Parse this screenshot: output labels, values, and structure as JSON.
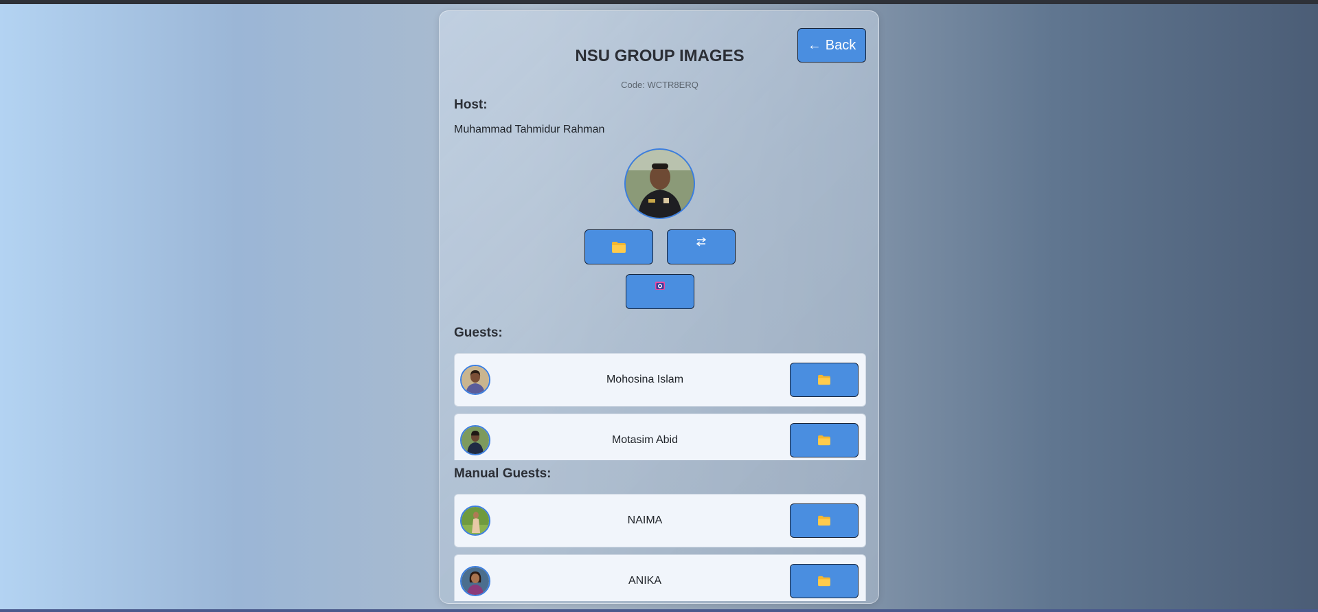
{
  "header": {
    "title": "NSU GROUP IMAGES",
    "code_text": "Code: WCTR8ERQ",
    "back_label": "Back",
    "back_arrow": "←"
  },
  "host": {
    "section_label": "Host:",
    "name": "Muhammad Tahmidur Rahman",
    "actions": [
      {
        "name": "folder-button",
        "icon": "folder-icon"
      },
      {
        "name": "swap-button",
        "icon": "swap-arrows-icon"
      },
      {
        "name": "camera-button",
        "icon": "camera-icon"
      }
    ]
  },
  "guests": {
    "section_label": "Guests:",
    "items": [
      {
        "name": "Mohosina Islam",
        "action_icon": "folder-icon"
      },
      {
        "name": "Motasim Abid",
        "action_icon": "folder-icon"
      }
    ]
  },
  "manual_guests": {
    "section_label": "Manual Guests:",
    "items": [
      {
        "name": "NAIMA",
        "action_icon": "folder-icon"
      },
      {
        "name": "ANIKA",
        "action_icon": "folder-icon"
      }
    ]
  },
  "colors": {
    "button_blue": "#4a8ee0",
    "avatar_border": "#3b7ee0",
    "row_background": "#f1f5fb"
  }
}
